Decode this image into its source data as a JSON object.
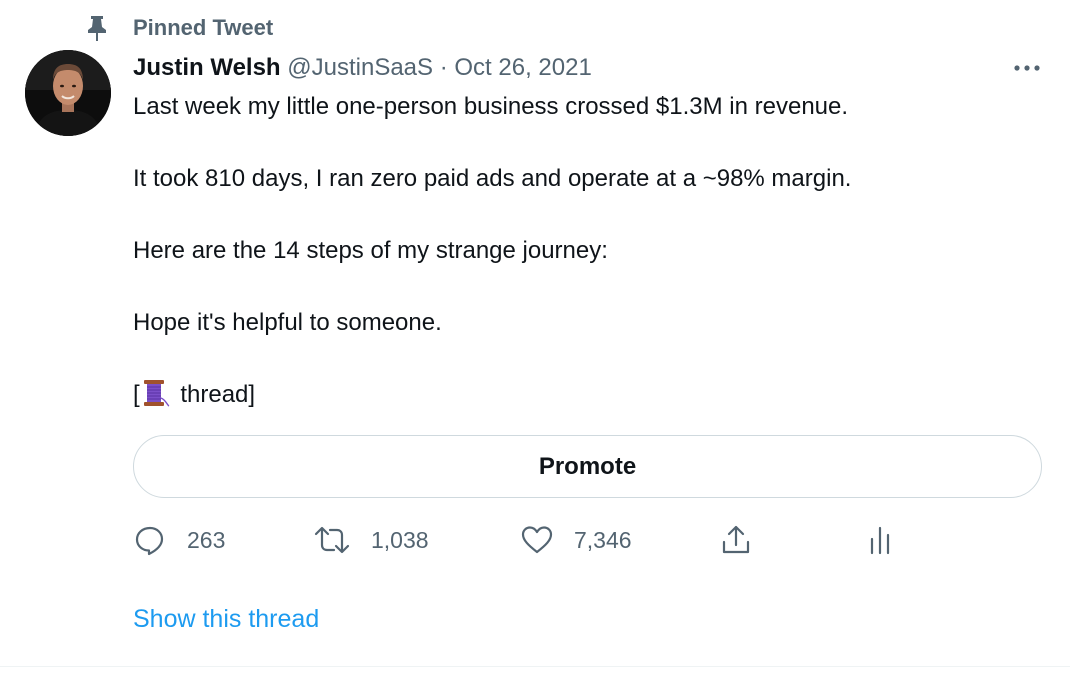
{
  "pinned": {
    "label": "Pinned Tweet",
    "icon": "pin-icon"
  },
  "author": {
    "display_name": "Justin Welsh",
    "handle": "@JustinSaaS",
    "separator": "·",
    "date": "Oct 26, 2021"
  },
  "tweet": {
    "paragraphs": [
      "Last week my little one-person business crossed $1.3M in revenue.",
      "It took 810 days, I ran zero paid ads and operate at a ~98% margin.",
      "Here are the 14 steps of my strange journey:",
      "Hope it's helpful to someone."
    ],
    "thread_open": "[",
    "thread_emoji": "spool-of-thread-emoji",
    "thread_text": " thread]"
  },
  "promote": {
    "label": "Promote"
  },
  "actions": {
    "replies": "263",
    "retweets": "1,038",
    "likes": "7,346",
    "share_icon": "share-icon",
    "analytics_icon": "analytics-icon"
  },
  "show_thread": {
    "label": "Show this thread"
  },
  "colors": {
    "text_primary": "#0f1419",
    "text_secondary": "#536471",
    "link": "#1d9bf0",
    "border": "#cfd9de"
  }
}
